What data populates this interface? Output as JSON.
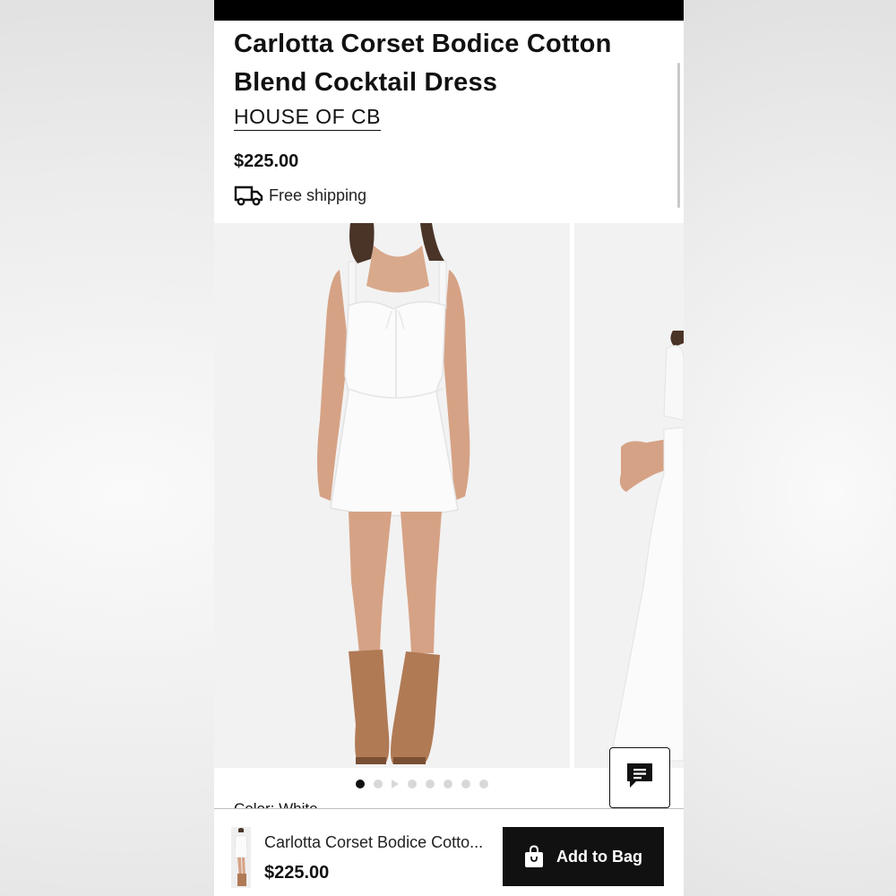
{
  "product": {
    "title": "Carlotta Corset Bodice Cotton Blend Cocktail Dress",
    "brand": "HOUSE OF CB",
    "price": "$225.00",
    "shipping": "Free shipping"
  },
  "gallery": {
    "slide_count": 8,
    "active_index": 0,
    "video_index": 2
  },
  "color_peek": "Color: White",
  "bottom_bar": {
    "title": "Carlotta Corset Bodice Cotto...",
    "price": "$225.00",
    "add_label": "Add to Bag"
  },
  "icons": {
    "shipping": "truck-icon",
    "chat": "chat-icon",
    "bag": "shopping-bag-icon"
  },
  "colors": {
    "button_bg": "#111111",
    "dot_active": "#111111",
    "dot_inactive": "#d8d8d8"
  }
}
